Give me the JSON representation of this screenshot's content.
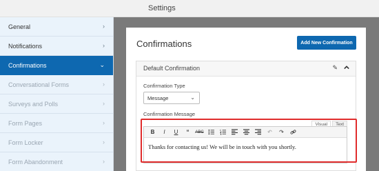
{
  "header": {
    "title": "Settings"
  },
  "sidebar": {
    "items": [
      {
        "label": "General",
        "state": "normal"
      },
      {
        "label": "Notifications",
        "state": "normal"
      },
      {
        "label": "Confirmations",
        "state": "active"
      },
      {
        "label": "Conversational Forms",
        "state": "muted"
      },
      {
        "label": "Surveys and Polls",
        "state": "muted"
      },
      {
        "label": "Form Pages",
        "state": "muted"
      },
      {
        "label": "Form Locker",
        "state": "muted"
      },
      {
        "label": "Form Abandonment",
        "state": "muted"
      }
    ]
  },
  "main": {
    "title": "Confirmations",
    "add_button": "Add New Confirmation",
    "card": {
      "title": "Default Confirmation",
      "type_label": "Confirmation Type",
      "type_value": "Message",
      "message_label": "Confirmation Message",
      "tabs": [
        "Visual",
        "Text"
      ],
      "message_text": "Thanks for contacting us! We will be in touch with you shortly."
    }
  },
  "colors": {
    "accent": "#0e68b0",
    "highlight": "#e02b2b"
  },
  "icons": [
    "chevron-right-icon",
    "chevron-down-icon",
    "pencil-icon",
    "collapse-up-icon",
    "bold-icon",
    "italic-icon",
    "underline-icon",
    "blockquote-icon",
    "strikethrough-icon",
    "bullet-list-icon",
    "numbered-list-icon",
    "align-left-icon",
    "align-center-icon",
    "align-right-icon",
    "undo-icon",
    "redo-icon",
    "link-icon"
  ]
}
